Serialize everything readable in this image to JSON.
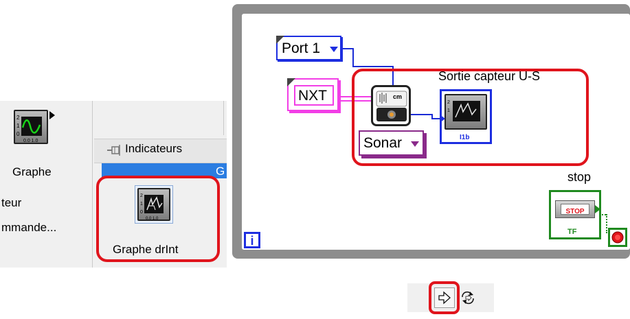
{
  "palette": {
    "graph_label": "Graphe",
    "indicators_label": "Indicateurs",
    "blue_band_letter": "G",
    "cut_item_1": "teur",
    "cut_item_2": "mmande...",
    "drint_label": "Graphe drInt"
  },
  "diagram": {
    "port_label": "Port 1",
    "nxt_label": "NXT",
    "sonar_label": "Sonar",
    "sensor_unit": "cm",
    "indicator_title": "Sortie capteur U-S",
    "indicator_type": "I1b",
    "stop_label": "stop",
    "stop_button": "STOP",
    "tf_label": "TF",
    "iteration_label": "i"
  },
  "colors": {
    "highlight": "#e0141c",
    "wire_blue": "#1a2bd6",
    "wire_pink": "#f23ee6",
    "sonar_purple": "#8a2a8a",
    "boolean_green": "#1f8a1f"
  },
  "toolbar": {
    "run_icon": "run-arrow-icon",
    "continuous_icon": "run-continuously-icon"
  }
}
